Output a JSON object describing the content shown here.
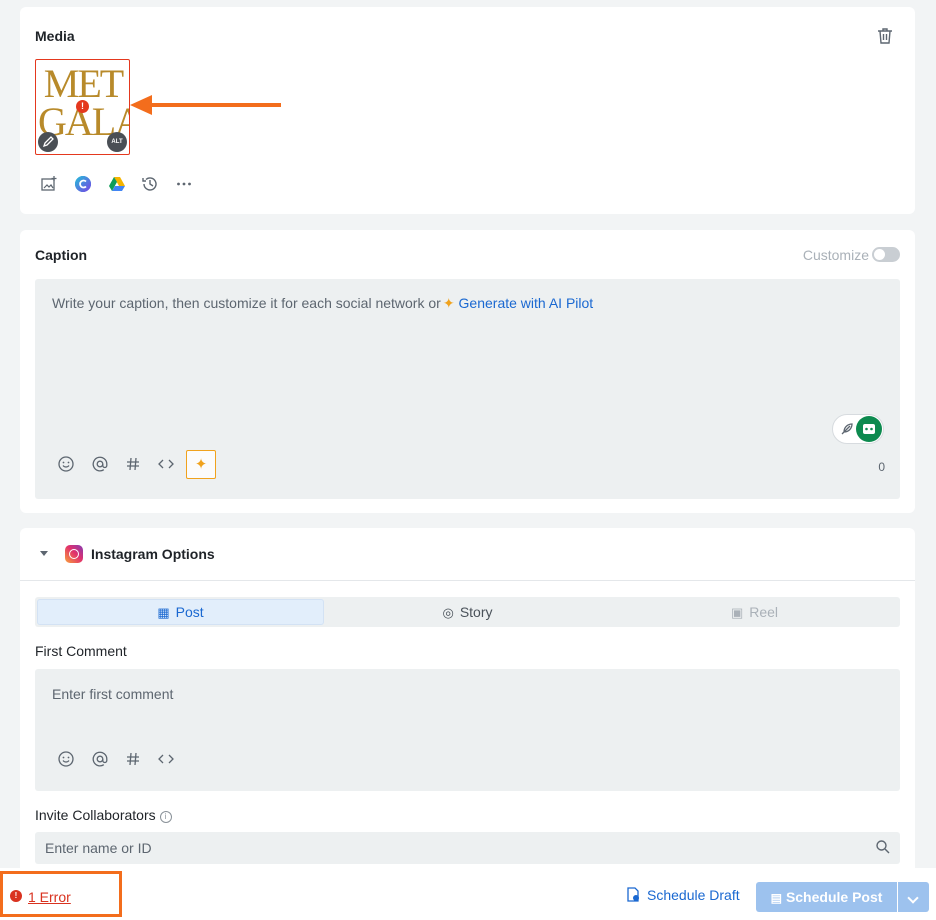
{
  "media": {
    "title": "Media",
    "thumbnail": {
      "line1": "MET",
      "line2": "GALA",
      "error_badge": "!",
      "alt_badge": "ALT"
    },
    "tools": [
      "add-image-icon",
      "canva-icon",
      "google-drive-icon",
      "history-icon",
      "more-icon"
    ]
  },
  "caption": {
    "title": "Caption",
    "customize_label": "Customize",
    "placeholder": "Write your caption, then customize it for each social network or",
    "ai_link": "Generate with AI Pilot",
    "char_count": "0",
    "tools": [
      "emoji-icon",
      "mention-icon",
      "hashtag-icon",
      "code-icon",
      "ai-sparkle-icon"
    ]
  },
  "instagram": {
    "title": "Instagram Options",
    "tabs": [
      {
        "label": "Post",
        "state": "active"
      },
      {
        "label": "Story",
        "state": "normal"
      },
      {
        "label": "Reel",
        "state": "disabled"
      }
    ],
    "first_comment_label": "First Comment",
    "first_comment_placeholder": "Enter first comment",
    "collaborators_label": "Invite Collaborators",
    "collaborators_placeholder": "Enter name or ID"
  },
  "footer": {
    "error_text": "1 Error",
    "draft_label": "Schedule Draft",
    "schedule_label": "Schedule Post"
  },
  "colors": {
    "accent": "#1a68d1",
    "error": "#d9321f",
    "highlight": "#f36d1c",
    "ai": "#f0a21d",
    "primary_disabled": "#9dc2ee"
  }
}
